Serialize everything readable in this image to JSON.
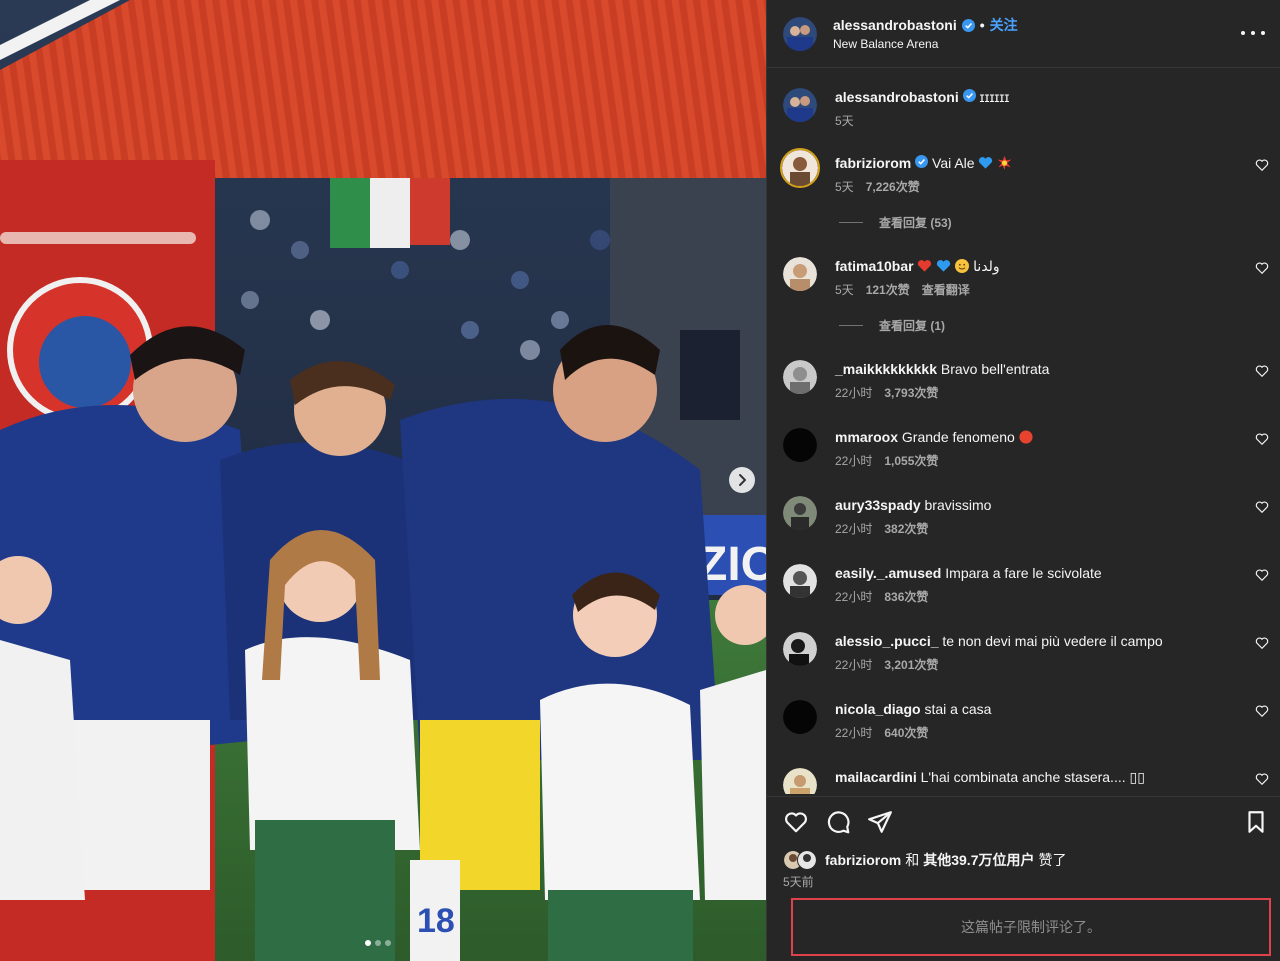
{
  "post": {
    "author": "alessandrobastoni",
    "follow_label": "关注",
    "separator": "•",
    "location": "New Balance Arena",
    "caption_text": "ɪɪɪɪɪɪ",
    "caption_time": "5天"
  },
  "media": {
    "slide_count": 3,
    "active_slide": 1,
    "jersey_number": "18",
    "board_text": "ZIO"
  },
  "comments": [
    {
      "user": "fabriziorom",
      "verified": true,
      "text": "Vai Ale",
      "emojis": [
        "blue-heart",
        "collision"
      ],
      "time": "5天",
      "likes": "7,226次赞",
      "replies": "查看回复 (53)"
    },
    {
      "user": "fatima10bar",
      "verified": false,
      "text": "ولدنا",
      "emojis": [
        "red-heart",
        "blue-heart",
        "smile"
      ],
      "time": "5天",
      "likes": "121次赞",
      "translate": "查看翻译",
      "replies": "查看回复 (1)"
    },
    {
      "user": "_maikkkkkkkkk",
      "verified": false,
      "text": "Bravo bell'entrata",
      "time": "22小时",
      "likes": "3,793次赞"
    },
    {
      "user": "mmaroox",
      "verified": false,
      "text": "Grande fenomeno",
      "emojis": [
        "red-circle"
      ],
      "time": "22小时",
      "likes": "1,055次赞"
    },
    {
      "user": "aury33spady",
      "verified": false,
      "text": "bravissimo",
      "time": "22小时",
      "likes": "382次赞"
    },
    {
      "user": "easily._.amused",
      "verified": false,
      "text": "Impara a fare le scivolate",
      "time": "22小时",
      "likes": "836次赞"
    },
    {
      "user": "alessio_.pucci_",
      "verified": false,
      "text": "te non devi mai più vedere il campo",
      "time": "22小时",
      "likes": "3,201次赞"
    },
    {
      "user": "nicola_diago",
      "verified": false,
      "text": "stai a casa",
      "time": "22小时",
      "likes": "640次赞"
    },
    {
      "user": "mailacardini",
      "verified": false,
      "text": "L'hai combinata anche stasera.... ▯▯",
      "time": "",
      "likes": ""
    }
  ],
  "likes_summary": {
    "user": "fabriziorom",
    "connector": "和",
    "others": "其他39.7万位用户",
    "suffix": "赞了"
  },
  "date_label": "5天前",
  "restricted_notice": "这篇帖子限制评论了。",
  "colors": {
    "panel_bg": "#262626",
    "divider": "#363636",
    "follow_blue": "#4aa3ff",
    "verified_blue": "#3897f0",
    "muted": "#a8a8a8",
    "highlight_border": "#e0414a"
  }
}
